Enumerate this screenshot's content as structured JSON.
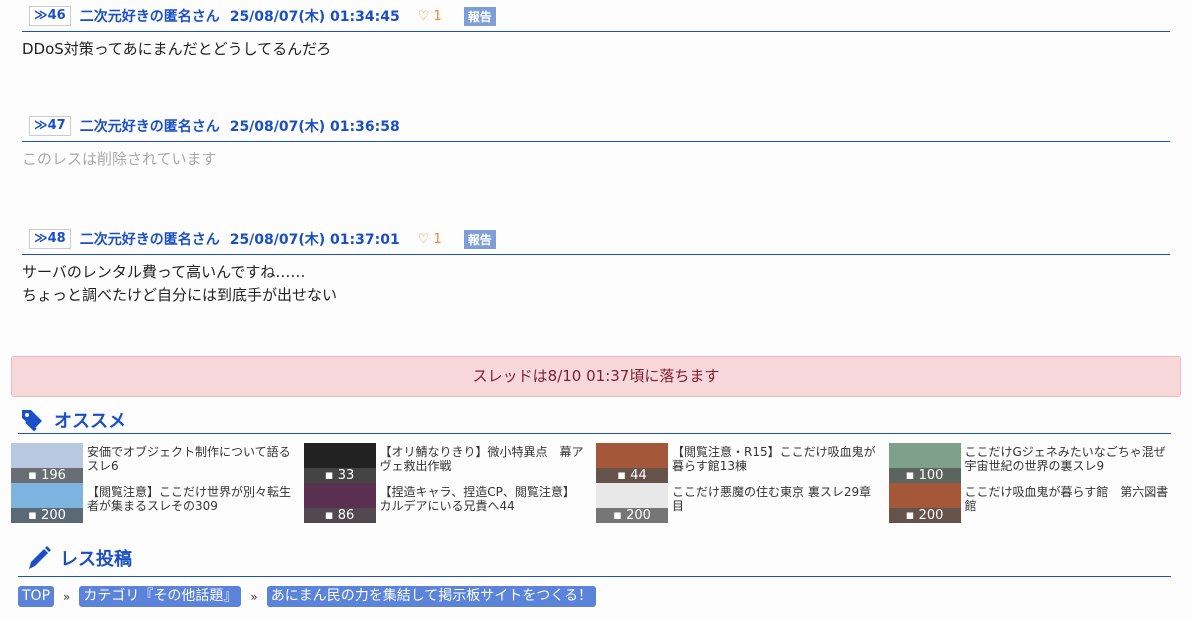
{
  "posts": [
    {
      "num": "≫46",
      "name": "二次元好きの匿名さん",
      "date": "25/08/07(木) 01:34:45",
      "likes": "1",
      "report": "報告",
      "lines": [
        "DDoS対策ってあにまんだとどうしてるんだろ"
      ]
    },
    {
      "num": "≫47",
      "name": "二次元好きの匿名さん",
      "date": "25/08/07(木) 01:36:58",
      "deleted": "このレスは削除されています"
    },
    {
      "num": "≫48",
      "name": "二次元好きの匿名さん",
      "date": "25/08/07(木) 01:37:01",
      "likes": "1",
      "report": "報告",
      "lines": [
        "サーバのレンタル費って高いんですね……",
        "ちょっと調べたけど自分には到底手が出せない"
      ]
    }
  ],
  "notice": "スレッドは8/10 01:37頃に落ちます",
  "recommend": {
    "title": "オススメ",
    "items": [
      {
        "title": "安価でオブジェクト制作について語るスレ6",
        "count": "196",
        "color": "#b8c8e0"
      },
      {
        "title": "【オリ鯖なりきり】微小特異点　幕アヴェ救出作戦",
        "count": "33",
        "color": "#222"
      },
      {
        "title": "【閲覧注意・R15】ここだけ吸血鬼が暮らす館13棟",
        "count": "44",
        "color": "#a5573a"
      },
      {
        "title": "ここだけGジェネみたいなごちゃ混ぜ宇宙世紀の世界の裏スレ9",
        "count": "100",
        "color": "#7fa08a"
      },
      {
        "title": "【閲覧注意】ここだけ世界が別々転生者が集まるスレその309",
        "count": "200",
        "color": "#7eb4e0"
      },
      {
        "title": "【捏造キャラ、捏造CP、閲覧注意】カルデアにいる兄貴へ44",
        "count": "86",
        "color": "#5a3050"
      },
      {
        "title": "ここだけ悪魔の住む東京 裏スレ29章目",
        "count": "200",
        "color": "#e8e8e8"
      },
      {
        "title": "ここだけ吸血鬼が暮らす館　第六図書館",
        "count": "200",
        "color": "#a5573a"
      }
    ]
  },
  "post_section": {
    "title": "レス投稿"
  },
  "breadcrumb": [
    "TOP",
    "カテゴリ『その他話題』",
    "あにまん民の力を集結して掲示板サイトをつくる！"
  ],
  "breadcrumb_sep": "»",
  "colors": {
    "accent": "#1a4fc8",
    "notice_bg": "#f8d7da",
    "chip": "#5a83d9"
  }
}
